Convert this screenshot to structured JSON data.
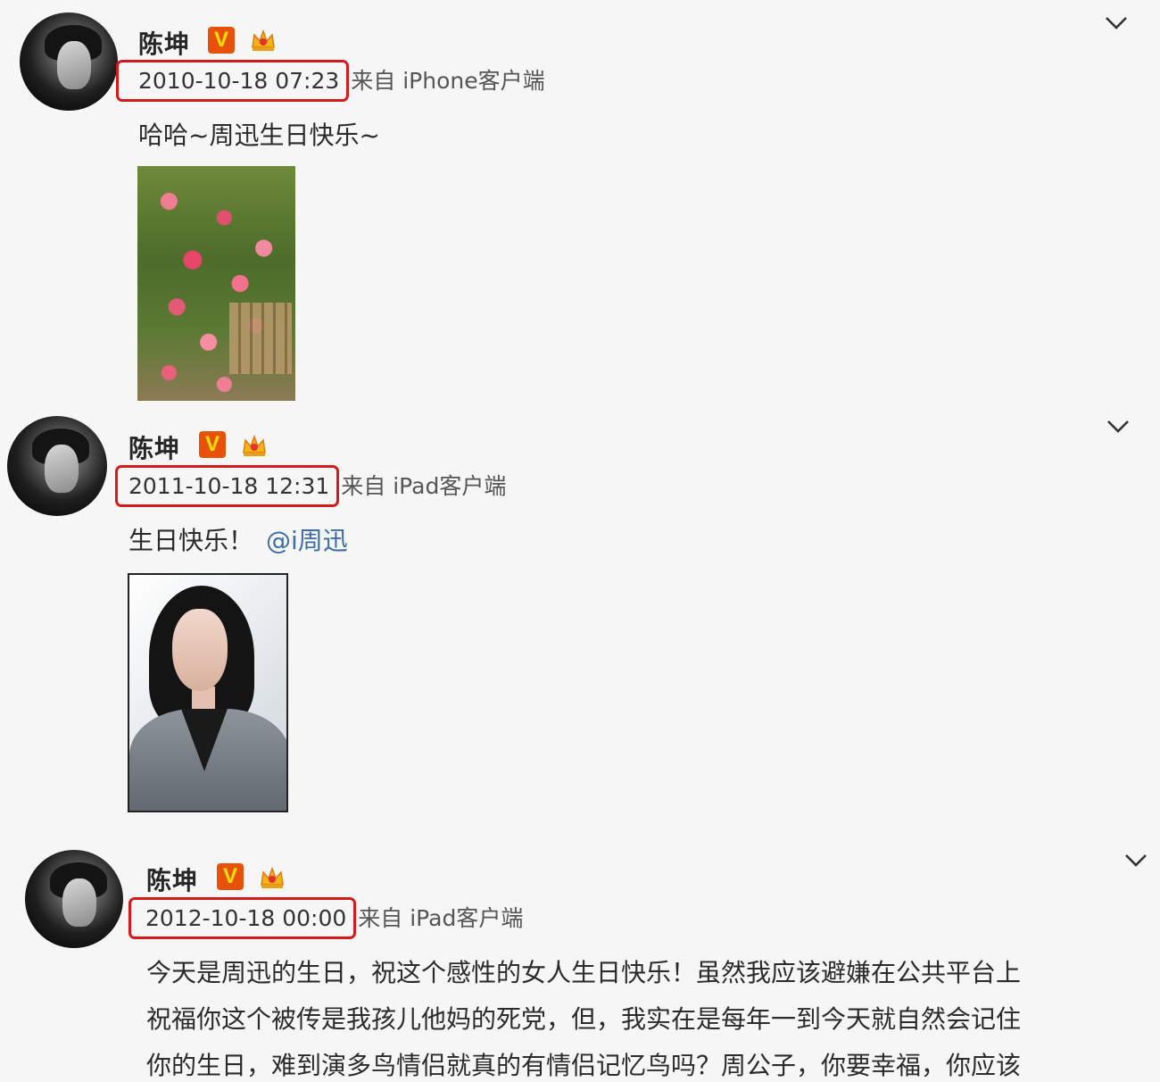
{
  "posts": [
    {
      "author": "陈坤",
      "verified_badge": "V",
      "date": "2010-10-18 07:23",
      "source": "来自 iPhone客户端",
      "text": "哈哈~周迅生日快乐~",
      "image": "roses-photo"
    },
    {
      "author": "陈坤",
      "verified_badge": "V",
      "date": "2011-10-18 12:31",
      "source": "来自 iPad客户端",
      "text": "生日快乐！",
      "mention": "@i周迅",
      "image": "portrait-photo"
    },
    {
      "author": "陈坤",
      "verified_badge": "V",
      "date": "2012-10-18 00:00",
      "source": "来自 iPad客户端",
      "lines": [
        "今天是周迅的生日，祝这个感性的女人生日快乐！虽然我应该避嫌在公共平台上",
        "祝福你这个被传是我孩儿他妈的死党，但，我实在是每年一到今天就自然会记住",
        "你的生日，难到演多鸟情侣就真的有情侣记忆鸟吗？周公子，你要幸福，你应该"
      ]
    }
  ],
  "colors": {
    "highlight_box": "#d41b1b",
    "verified_badge": "#e8510a",
    "mention": "#3b6ea8"
  },
  "icons": [
    "chevron-down-icon",
    "verified-v-icon",
    "crown-icon"
  ]
}
